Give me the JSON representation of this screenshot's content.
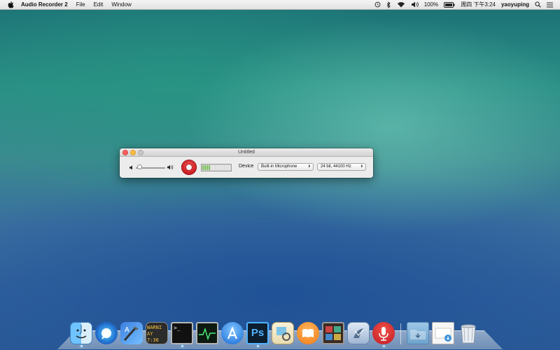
{
  "menubar": {
    "app_name": "Audio Recorder 2",
    "menus": [
      "File",
      "Edit",
      "Window"
    ],
    "battery": "100%",
    "datetime": "周四 下午3:24",
    "user": "yaoyuping"
  },
  "window": {
    "title": "Untitled",
    "device_label": "Device",
    "device_value": "Built-in Microphone",
    "format_value": "24 bit, 44100 Hz",
    "volume_level": 0.05,
    "meter_level": 0.25
  },
  "dock": {
    "items": [
      "finder-icon",
      "safari-icon",
      "xcode-icon",
      "console-icon",
      "terminal-icon",
      "activity-monitor-icon",
      "app-store-icon",
      "photoshop-icon",
      "preview-icon",
      "ibooks-icon",
      "photo-booth-icon",
      "mail-icon",
      "audio-recorder-icon",
      "documents-folder-icon",
      "downloads-stack-icon",
      "trash-icon"
    ],
    "console_text_1": "WARNI",
    "console_text_2": "AY 7:36",
    "photoshop_text": "Ps"
  }
}
